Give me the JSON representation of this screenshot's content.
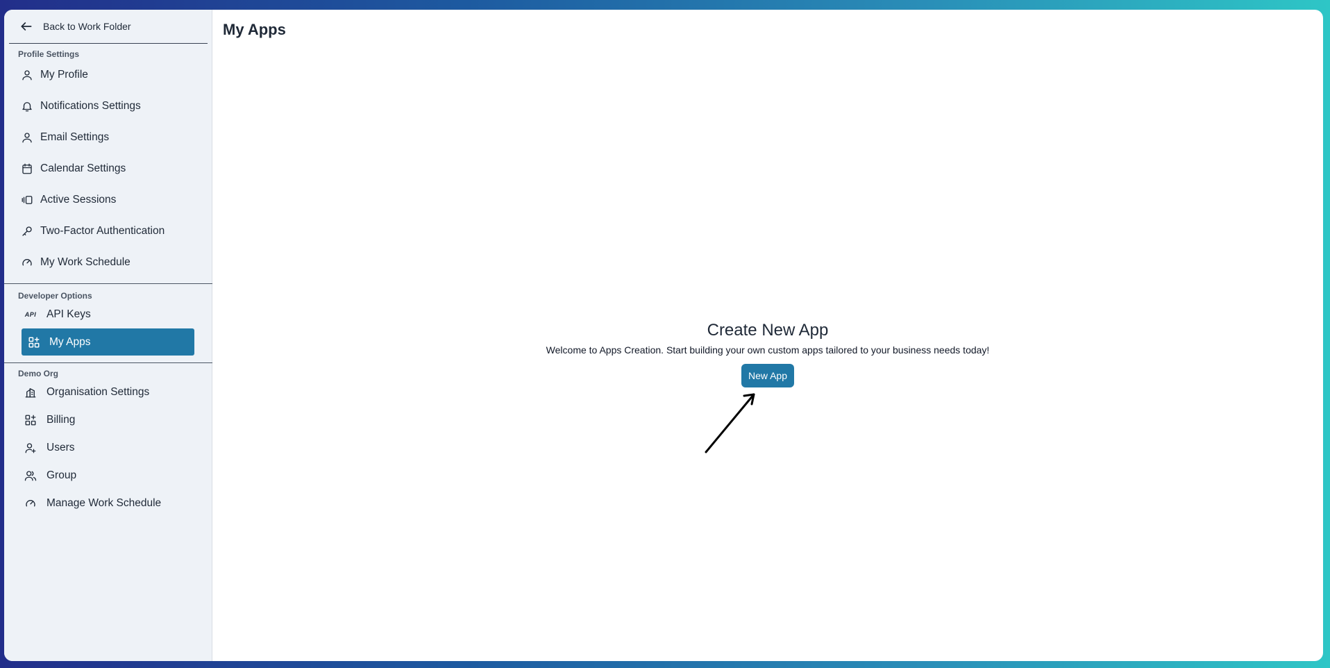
{
  "sidebar": {
    "back_label": "Back to Work Folder",
    "profile_section": {
      "title": "Profile Settings",
      "items": [
        {
          "label": "My Profile",
          "icon": "user-icon"
        },
        {
          "label": "Notifications Settings",
          "icon": "bell-icon"
        },
        {
          "label": "Email Settings",
          "icon": "user-icon"
        },
        {
          "label": "Calendar Settings",
          "icon": "calendar-icon"
        },
        {
          "label": "Active Sessions",
          "icon": "sessions-icon"
        },
        {
          "label": "Two-Factor Authentication",
          "icon": "key-icon"
        },
        {
          "label": "My Work Schedule",
          "icon": "gauge-icon"
        }
      ]
    },
    "developer_section": {
      "title": "Developer Options",
      "items": [
        {
          "label": "API Keys",
          "icon": "api-icon",
          "icon_text": "API"
        },
        {
          "label": "My Apps",
          "icon": "apps-icon",
          "active": true
        }
      ]
    },
    "org_section": {
      "title": "Demo Org",
      "items": [
        {
          "label": "Organisation Settings",
          "icon": "building-icon"
        },
        {
          "label": "Billing",
          "icon": "apps-icon"
        },
        {
          "label": "Users",
          "icon": "user-plus-icon"
        },
        {
          "label": "Group",
          "icon": "users-icon"
        },
        {
          "label": "Manage Work Schedule",
          "icon": "gauge-icon"
        }
      ]
    }
  },
  "main": {
    "page_title": "My Apps",
    "empty_state": {
      "title": "Create New App",
      "description": "Welcome to Apps Creation. Start building your own custom apps tailored to your business needs today!",
      "button_label": "New App"
    }
  },
  "colors": {
    "accent": "#2178a6",
    "sidebar_bg": "#eef2f7"
  }
}
